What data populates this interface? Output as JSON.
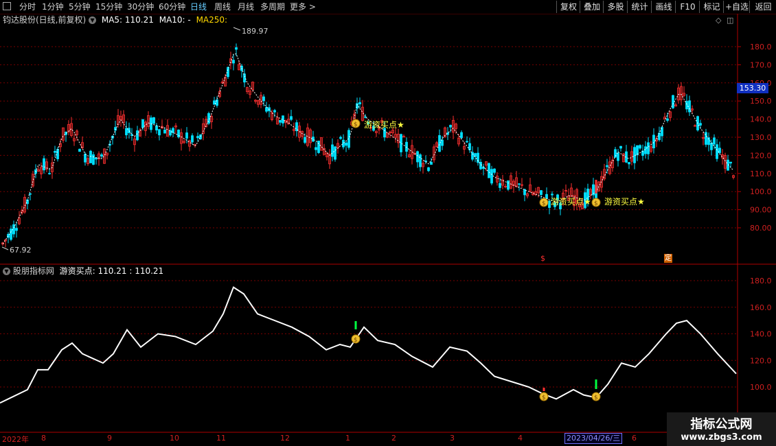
{
  "toolbar": {
    "periods": [
      "分时",
      "1分钟",
      "5分钟",
      "15分钟",
      "30分钟",
      "60分钟",
      "日线",
      "周线",
      "月线",
      "多周期",
      "更多 >"
    ],
    "buttons": [
      "复权",
      "叠加",
      "多股",
      "统计",
      "画线",
      "F10",
      "标记",
      "+自选",
      "返回"
    ]
  },
  "main_panel": {
    "stock": "钧达股份(日线,前复权)",
    "ma5_label": "MA5: 110.21",
    "ma10_label": "MA10: -",
    "ma250_label": "MA250:",
    "high_marker": "189.97",
    "low_marker": "67.92",
    "last_price": "153.30",
    "signal_text": "游资买点",
    "signal_star": "★",
    "badge_s": "$",
    "badge_ding": "定",
    "y_ticks": [
      "180.0",
      "170.0",
      "160.0",
      "150.0",
      "140.0",
      "130.0",
      "120.0",
      "110.0",
      "100.0",
      "90.00",
      "80.00"
    ]
  },
  "indicator_panel": {
    "title": "股朋指标网",
    "formula": "游资买点: 110.21 : 110.21",
    "y_ticks": [
      "180.0",
      "160.0",
      "140.0",
      "120.0",
      "100.0"
    ]
  },
  "time_axis": {
    "labels": [
      "2022年",
      "8",
      "9",
      "10",
      "11",
      "12",
      "1",
      "2",
      "3",
      "4",
      "6"
    ],
    "selected_date": "2023/04/26/三"
  },
  "watermark": {
    "line1": "指标公式网",
    "line2": "www.zbgs3.com"
  },
  "colors": {
    "up": "#ff3030",
    "down": "#00e0ff",
    "grid": "#7a0000",
    "line": "#ffffff",
    "signal": "#ffff40"
  },
  "chart_data": {
    "type": "candlestick",
    "x": [
      "2022-07",
      "2022-08",
      "2022-09",
      "2022-10",
      "2022-11",
      "2022-12",
      "2023-01",
      "2023-02",
      "2023-03",
      "2023-04",
      "2023-05",
      "2023-06"
    ],
    "close_approx": [
      75,
      130,
      140,
      140,
      175,
      135,
      140,
      125,
      130,
      100,
      95,
      150
    ],
    "ylim": [
      70,
      190
    ]
  }
}
